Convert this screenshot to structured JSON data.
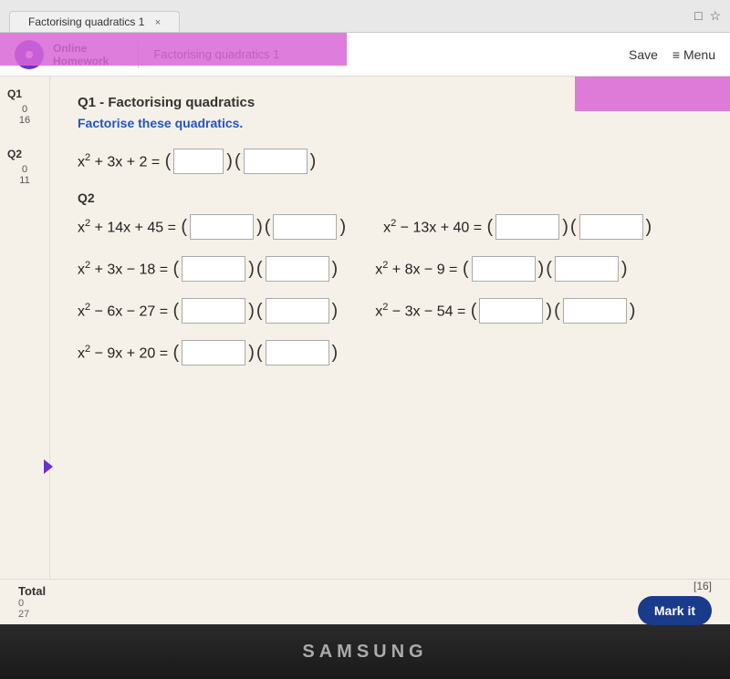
{
  "browser": {
    "tab_label": "Factorising quadratics 1",
    "close_x": "×",
    "controls": [
      "□",
      "☆"
    ]
  },
  "header": {
    "app_name_line1": "Online",
    "app_name_line2": "Homework",
    "hw_title": "Factorising quadratics 1",
    "save_label": "Save",
    "menu_label": "≡ Menu"
  },
  "sidebar": {
    "q1_label": "Q1",
    "q1_score_top": "0",
    "q1_score_bottom": "16",
    "q2_label": "Q2",
    "q2_score_top": "0",
    "q2_score_bottom": "11",
    "total_label": "Total",
    "total_score_top": "0",
    "total_score_bottom": "27"
  },
  "question1": {
    "number": "Q1",
    "title": "Q1 - Factorising quadratics",
    "instruction": "Factorise these quadratics.",
    "eq1": {
      "lhs": "x² + 3x + 2 =",
      "placeholder1": "",
      "placeholder2": ""
    }
  },
  "question2": {
    "number": "Q2",
    "equations": [
      {
        "lhs": "x² + 14x + 45 =",
        "p1": "",
        "p2": ""
      },
      {
        "lhs": "x² − 13x + 40 =",
        "p1": "",
        "p2": ""
      },
      {
        "lhs": "x² + 3x − 18 =",
        "p1": "",
        "p2": ""
      },
      {
        "lhs": "x² + 8x − 9 =",
        "p1": "",
        "p2": ""
      },
      {
        "lhs": "x² − 6x − 27 =",
        "p1": "",
        "p2": ""
      },
      {
        "lhs": "x² − 3x − 54 =",
        "p1": "",
        "p2": ""
      },
      {
        "lhs": "x² − 9x + 20 =",
        "p1": "",
        "p2": ""
      }
    ]
  },
  "bottom": {
    "total_label": "Total",
    "score_bracket": "[16]",
    "mark_it_label": "Mark it"
  },
  "taskbar": {
    "samsung_label": "SAMSUNG"
  }
}
